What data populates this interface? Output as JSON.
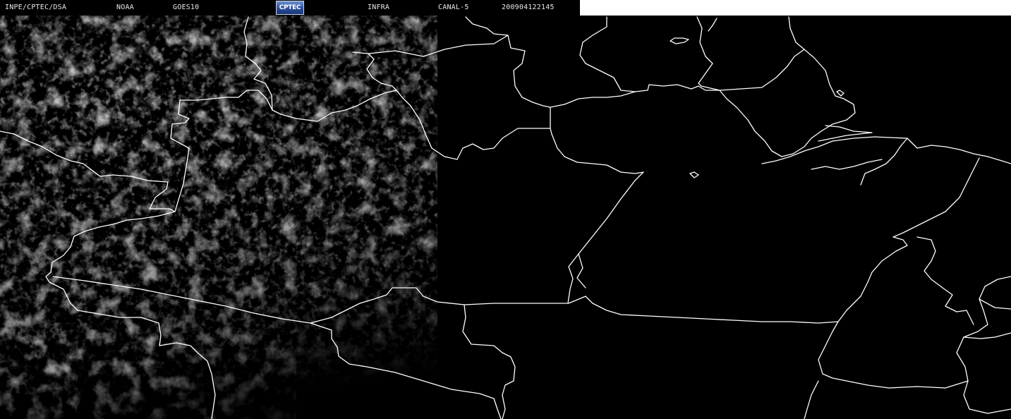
{
  "header": {
    "institution": "INPE/CPTEC/DSA",
    "agency": "NOAA",
    "satellite": "GOES10",
    "logo_text": "CPTEC",
    "band": "INFRA",
    "channel": "CANAL-5",
    "timestamp": "200904122145"
  },
  "colors": {
    "background": "#000000",
    "boundaries": "#ffffff",
    "clouds": "#8a8a8a",
    "header_text": "#e8e8e8",
    "header_blank": "#ffffff"
  },
  "map": {
    "imagery": "infrared satellite image, grayscale",
    "overlay": "political boundaries"
  }
}
